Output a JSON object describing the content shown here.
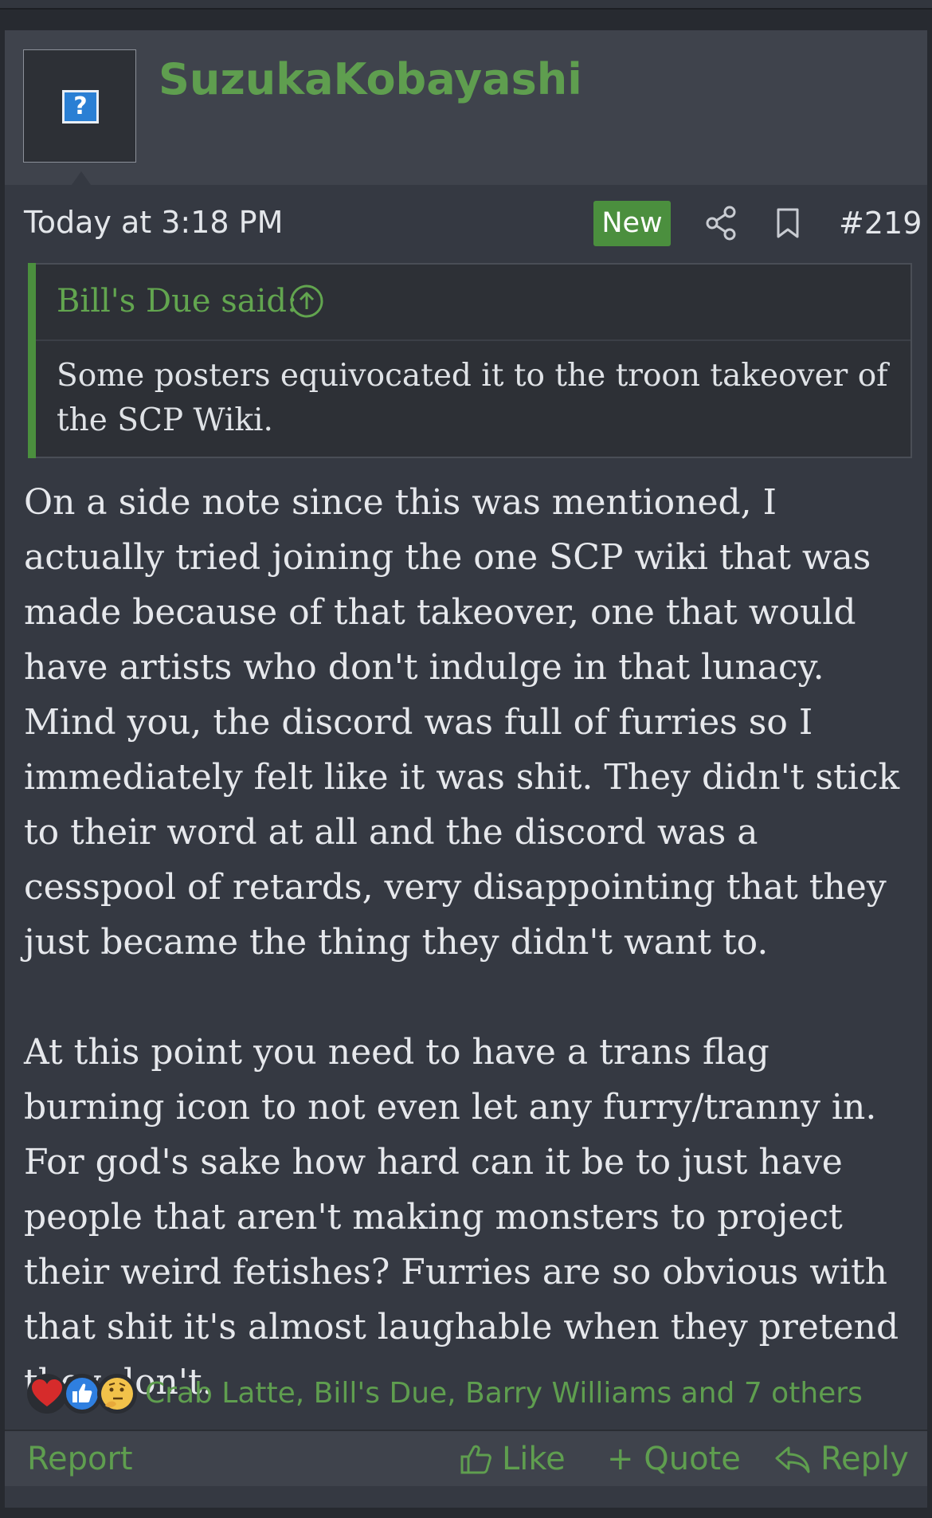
{
  "post": {
    "username": "SuzukaKobayashi",
    "avatar_symbol": "?",
    "timestamp": "Today at 3:18 PM",
    "new_badge": "New",
    "post_number": "#219",
    "quote": {
      "author_line": "Bill's Due said:",
      "text": "Some posters equivocated it to the troon takeover of the SCP Wiki."
    },
    "paragraphs": [
      "On a side note since this was mentioned, I actually tried joining the one SCP wiki that was made because of that takeover, one that would have artists who don't indulge in that lunacy. Mind you, the discord was full of furries so I immediately felt like it was shit. They didn't stick to their word at all and the discord was a cesspool of retards, very disappointing that they just became the thing they didn't want to.",
      "At this point you need to have a trans flag burning icon to not even let any furry/tranny in. For god's sake how hard can it be to just have people that aren't making monsters to project their weird fetishes? Furries are so obvious with that shit it's almost laughable when they pretend they don't."
    ],
    "reactions": {
      "icons": [
        "heart-icon",
        "thumbs-up-icon",
        "thinking-face-icon"
      ],
      "summary": "Crab Latte, Bill's Due, Barry Williams and 7 others"
    },
    "actions": {
      "report": "Report",
      "like": "Like",
      "quote": "+ Quote",
      "reply": "Reply"
    }
  },
  "colors": {
    "accent_green": "#5f9e4f",
    "background": "#353942",
    "header": "#3f434c"
  }
}
